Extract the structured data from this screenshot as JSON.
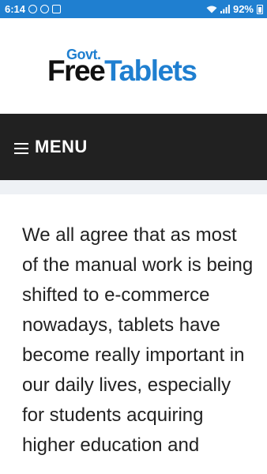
{
  "status_bar": {
    "time": "6:14",
    "battery": "92%",
    "icons_left": [
      "whatsapp-icon",
      "messenger-icon",
      "gallery-icon"
    ],
    "icons_right": [
      "wifi-icon",
      "signal-icon",
      "battery-icon"
    ]
  },
  "logo": {
    "govt": "Govt.",
    "free": "Free",
    "tablets": "Tablets"
  },
  "menu": {
    "label": "MENU"
  },
  "article": {
    "text": "We all agree that as most of the manual work is being shifted to e-commerce nowadays, tablets have become really important in our daily lives, especially for students acquiring higher education and"
  },
  "colors": {
    "status_bar": "#1f7fd0",
    "brand_blue": "#1f7fd0",
    "menu_bar": "#212121",
    "text": "#222222"
  }
}
